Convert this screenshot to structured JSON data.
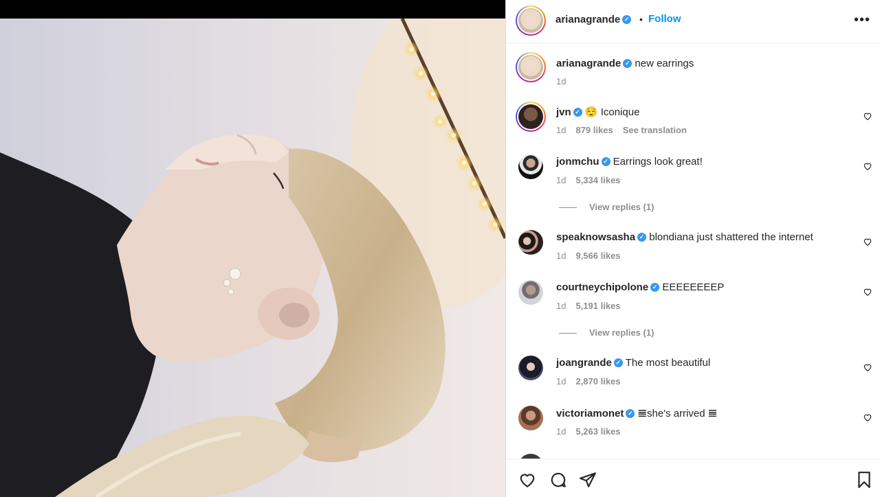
{
  "post": {
    "username": "arianagrande",
    "follow_label": "Follow",
    "dot": "•"
  },
  "caption": {
    "username": "arianagrande",
    "text": "new earrings",
    "time": "1d"
  },
  "comments": [
    {
      "username": "jvn",
      "text": "😌 Iconique",
      "time": "1d",
      "likes": "879 likes",
      "translation": "See translation"
    },
    {
      "username": "jonmchu",
      "text": "Earrings look great!",
      "time": "1d",
      "likes": "5,334 likes",
      "replies": "View replies (1)"
    },
    {
      "username": "speaknowsasha",
      "text": "blondiana just shattered the internet",
      "time": "1d",
      "likes": "9,566 likes"
    },
    {
      "username": "courtneychipolone",
      "text": "EEEEEEEEP",
      "time": "1d",
      "likes": "5,191 likes",
      "replies": "View replies (1)"
    },
    {
      "username": "joangrande",
      "text": "The most beautiful",
      "time": "1d",
      "likes": "2,870 likes"
    },
    {
      "username": "victoriamonet",
      "text": "𝌆she's arrived 𝌆",
      "time": "1d",
      "likes": "5,263 likes"
    }
  ],
  "icons": {
    "verified": "verified-badge-icon",
    "more": "more-options-icon",
    "like": "heart-icon",
    "comment": "comment-icon",
    "share": "share-icon",
    "save": "bookmark-icon"
  },
  "colors": {
    "accent": "#0095f6",
    "verified": "#3897f0",
    "muted": "#8e8e8e",
    "text": "#262626"
  }
}
